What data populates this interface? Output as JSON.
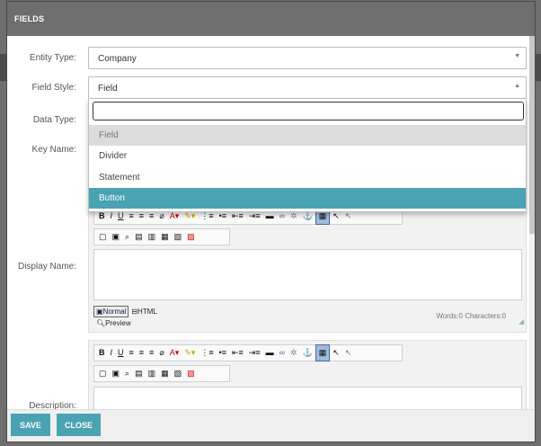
{
  "modal": {
    "title": "FIELDS"
  },
  "form": {
    "entity_type": {
      "label": "Entity Type:",
      "value": "Company",
      "arrow_icon": "chevron-down-icon"
    },
    "field_style": {
      "label": "Field Style:",
      "value": "Field",
      "arrow_icon": "chevron-up-icon"
    },
    "data_type": {
      "label": "Data Type:"
    },
    "key_name": {
      "label": "Key Name:"
    },
    "display_name": {
      "label": "Display Name:"
    },
    "description": {
      "label": "Description:"
    }
  },
  "dropdown": {
    "search_value": "",
    "options": [
      "Field",
      "Divider",
      "Statement",
      "Button"
    ],
    "highlighted": "Button",
    "selected": "Field"
  },
  "editor": {
    "toolbar1": [
      "B",
      "I",
      "U",
      "≡",
      "≡",
      "≡",
      "⌀",
      "A▾",
      "✎▾",
      "⋮≡",
      "•≡",
      "⇤≡",
      "⇥≡",
      "▬",
      "∞",
      "✲",
      "⚓",
      "▦",
      "↖",
      "↖"
    ],
    "toolbar2": [
      "▢",
      "▣",
      "⌕",
      "▤",
      "▥",
      "▦",
      "▧",
      "▨"
    ],
    "mode_normal": "Normal",
    "mode_html": "HTML",
    "mode_preview": "Preview",
    "wordcount": "Words:0 Characters:0"
  },
  "footer": {
    "save": "SAVE",
    "close": "CLOSE"
  },
  "colors": {
    "accent": "#4aa3b2",
    "header": "#6e6e6e"
  }
}
